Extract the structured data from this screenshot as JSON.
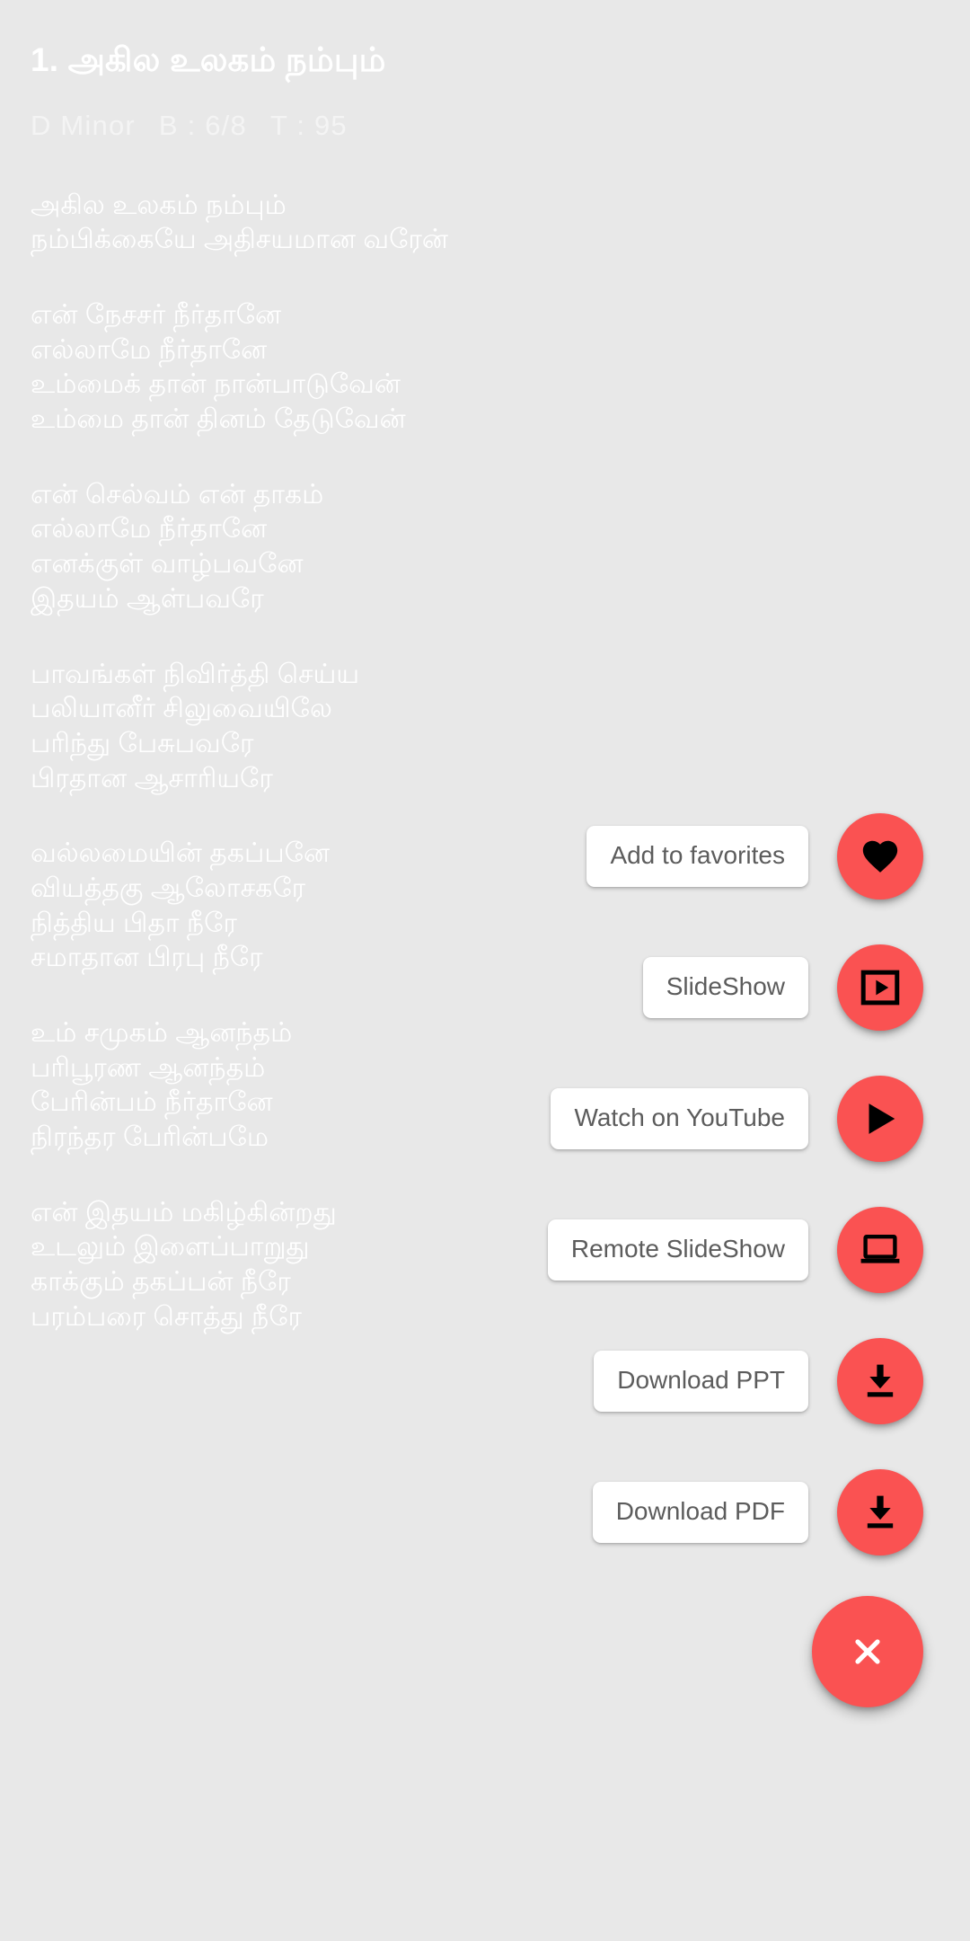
{
  "theme": {
    "background": "#e8e8e8",
    "fab_red": "#fa5252",
    "label_bg": "#ffffff",
    "label_text": "#5c5c5c",
    "lyric_text": "#ffffff"
  },
  "song": {
    "title": "1. அகில உலகம் நம்பும்",
    "key": "D Minor",
    "beat": "B : 6/8",
    "tempo": "T : 95",
    "stanzas": [
      {
        "lines": [
          "அகில உலகம் நம்பும்",
          "நம்பிக்கையே அதிசயமான வரேன்"
        ]
      },
      {
        "lines": [
          "என் நேசசர் நீர்தானே",
          "எல்லாமே நீர்தானே",
          "உம்மைக் தான் நான்பாடுவேன்",
          "உம்மை தான் தினம் தேடுவேன்"
        ]
      },
      {
        "lines": [
          "என் செல்வம் என் தாகம்",
          "எல்லாமே நீர்தானே",
          "எனக்குள் வாழ்பவனே",
          "இதயம் ஆள்பவரே"
        ]
      },
      {
        "lines": [
          "பாவங்கள் நிவிர்த்தி செய்ய",
          "பலியானீர் சிலுவையிலே",
          "பரிந்து பேசுபவரே",
          "பிரதான ஆசாரியரே"
        ]
      },
      {
        "lines": [
          "வல்லமையின் தகப்பனே",
          "வியத்தகு ஆலோசகரே",
          "நித்திய பிதா நீரே",
          "சமாதான பிரபு நீரே"
        ]
      },
      {
        "lines": [
          "உம் சமுகம் ஆனந்தம்",
          "பரிபூரண ஆனந்தம்",
          "பேரின்பம் நீர்தானே",
          "நிரந்தர பேரின்பமே"
        ]
      },
      {
        "lines": [
          "என் இதயம் மகிழ்கின்றது",
          "உடலும் இளைப்பாறுது",
          "காக்கும் தகப்பன் நீரே",
          "பரம்பரை சொத்து நீரே"
        ]
      }
    ]
  },
  "fab_menu": {
    "items": [
      {
        "label": "Add to favorites",
        "icon": "heart-icon"
      },
      {
        "label": "SlideShow",
        "icon": "slideshow-icon"
      },
      {
        "label": "Watch on YouTube",
        "icon": "play-icon"
      },
      {
        "label": "Remote SlideShow",
        "icon": "laptop-icon"
      },
      {
        "label": "Download PPT",
        "icon": "download-icon"
      },
      {
        "label": "Download PDF",
        "icon": "download-icon"
      }
    ],
    "close": {
      "icon": "close-icon",
      "label": "Close menu"
    }
  }
}
